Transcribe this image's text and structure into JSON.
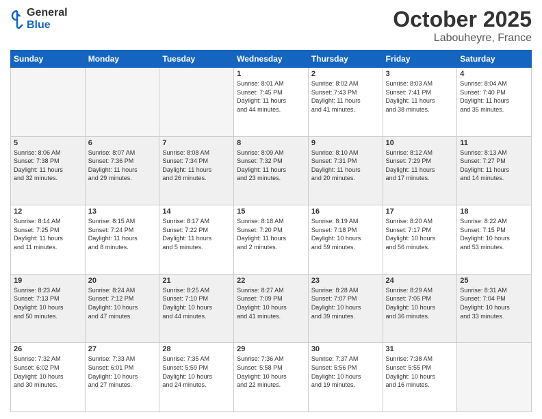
{
  "header": {
    "logo_general": "General",
    "logo_blue": "Blue",
    "month": "October 2025",
    "location": "Labouheyre, France"
  },
  "weekdays": [
    "Sunday",
    "Monday",
    "Tuesday",
    "Wednesday",
    "Thursday",
    "Friday",
    "Saturday"
  ],
  "rows": [
    {
      "shaded": false,
      "cells": [
        {
          "day": "",
          "info": ""
        },
        {
          "day": "",
          "info": ""
        },
        {
          "day": "",
          "info": ""
        },
        {
          "day": "1",
          "info": "Sunrise: 8:01 AM\nSunset: 7:45 PM\nDaylight: 11 hours\nand 44 minutes."
        },
        {
          "day": "2",
          "info": "Sunrise: 8:02 AM\nSunset: 7:43 PM\nDaylight: 11 hours\nand 41 minutes."
        },
        {
          "day": "3",
          "info": "Sunrise: 8:03 AM\nSunset: 7:41 PM\nDaylight: 11 hours\nand 38 minutes."
        },
        {
          "day": "4",
          "info": "Sunrise: 8:04 AM\nSunset: 7:40 PM\nDaylight: 11 hours\nand 35 minutes."
        }
      ]
    },
    {
      "shaded": true,
      "cells": [
        {
          "day": "5",
          "info": "Sunrise: 8:06 AM\nSunset: 7:38 PM\nDaylight: 11 hours\nand 32 minutes."
        },
        {
          "day": "6",
          "info": "Sunrise: 8:07 AM\nSunset: 7:36 PM\nDaylight: 11 hours\nand 29 minutes."
        },
        {
          "day": "7",
          "info": "Sunrise: 8:08 AM\nSunset: 7:34 PM\nDaylight: 11 hours\nand 26 minutes."
        },
        {
          "day": "8",
          "info": "Sunrise: 8:09 AM\nSunset: 7:32 PM\nDaylight: 11 hours\nand 23 minutes."
        },
        {
          "day": "9",
          "info": "Sunrise: 8:10 AM\nSunset: 7:31 PM\nDaylight: 11 hours\nand 20 minutes."
        },
        {
          "day": "10",
          "info": "Sunrise: 8:12 AM\nSunset: 7:29 PM\nDaylight: 11 hours\nand 17 minutes."
        },
        {
          "day": "11",
          "info": "Sunrise: 8:13 AM\nSunset: 7:27 PM\nDaylight: 11 hours\nand 14 minutes."
        }
      ]
    },
    {
      "shaded": false,
      "cells": [
        {
          "day": "12",
          "info": "Sunrise: 8:14 AM\nSunset: 7:25 PM\nDaylight: 11 hours\nand 11 minutes."
        },
        {
          "day": "13",
          "info": "Sunrise: 8:15 AM\nSunset: 7:24 PM\nDaylight: 11 hours\nand 8 minutes."
        },
        {
          "day": "14",
          "info": "Sunrise: 8:17 AM\nSunset: 7:22 PM\nDaylight: 11 hours\nand 5 minutes."
        },
        {
          "day": "15",
          "info": "Sunrise: 8:18 AM\nSunset: 7:20 PM\nDaylight: 11 hours\nand 2 minutes."
        },
        {
          "day": "16",
          "info": "Sunrise: 8:19 AM\nSunset: 7:18 PM\nDaylight: 10 hours\nand 59 minutes."
        },
        {
          "day": "17",
          "info": "Sunrise: 8:20 AM\nSunset: 7:17 PM\nDaylight: 10 hours\nand 56 minutes."
        },
        {
          "day": "18",
          "info": "Sunrise: 8:22 AM\nSunset: 7:15 PM\nDaylight: 10 hours\nand 53 minutes."
        }
      ]
    },
    {
      "shaded": true,
      "cells": [
        {
          "day": "19",
          "info": "Sunrise: 8:23 AM\nSunset: 7:13 PM\nDaylight: 10 hours\nand 50 minutes."
        },
        {
          "day": "20",
          "info": "Sunrise: 8:24 AM\nSunset: 7:12 PM\nDaylight: 10 hours\nand 47 minutes."
        },
        {
          "day": "21",
          "info": "Sunrise: 8:25 AM\nSunset: 7:10 PM\nDaylight: 10 hours\nand 44 minutes."
        },
        {
          "day": "22",
          "info": "Sunrise: 8:27 AM\nSunset: 7:09 PM\nDaylight: 10 hours\nand 41 minutes."
        },
        {
          "day": "23",
          "info": "Sunrise: 8:28 AM\nSunset: 7:07 PM\nDaylight: 10 hours\nand 39 minutes."
        },
        {
          "day": "24",
          "info": "Sunrise: 8:29 AM\nSunset: 7:05 PM\nDaylight: 10 hours\nand 36 minutes."
        },
        {
          "day": "25",
          "info": "Sunrise: 8:31 AM\nSunset: 7:04 PM\nDaylight: 10 hours\nand 33 minutes."
        }
      ]
    },
    {
      "shaded": false,
      "cells": [
        {
          "day": "26",
          "info": "Sunrise: 7:32 AM\nSunset: 6:02 PM\nDaylight: 10 hours\nand 30 minutes."
        },
        {
          "day": "27",
          "info": "Sunrise: 7:33 AM\nSunset: 6:01 PM\nDaylight: 10 hours\nand 27 minutes."
        },
        {
          "day": "28",
          "info": "Sunrise: 7:35 AM\nSunset: 5:59 PM\nDaylight: 10 hours\nand 24 minutes."
        },
        {
          "day": "29",
          "info": "Sunrise: 7:36 AM\nSunset: 5:58 PM\nDaylight: 10 hours\nand 22 minutes."
        },
        {
          "day": "30",
          "info": "Sunrise: 7:37 AM\nSunset: 5:56 PM\nDaylight: 10 hours\nand 19 minutes."
        },
        {
          "day": "31",
          "info": "Sunrise: 7:38 AM\nSunset: 5:55 PM\nDaylight: 10 hours\nand 16 minutes."
        },
        {
          "day": "",
          "info": ""
        }
      ]
    }
  ]
}
